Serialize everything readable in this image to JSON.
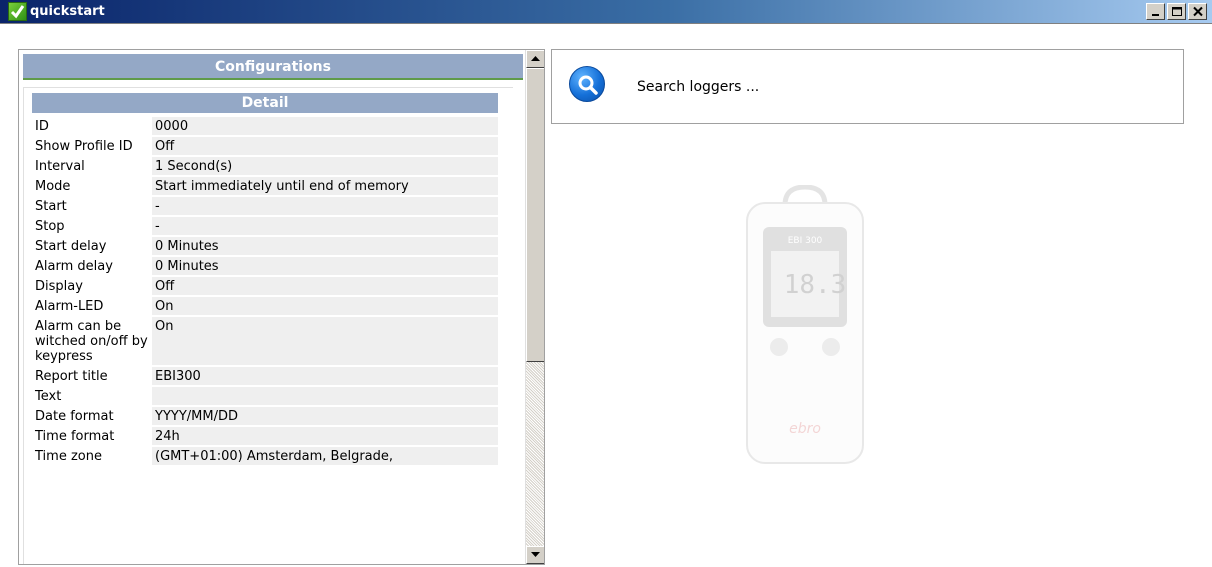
{
  "window": {
    "title": "quickstart",
    "controls": [
      "minimize",
      "maximize",
      "close"
    ]
  },
  "configurations": {
    "header": "Configurations",
    "detail": {
      "header": "Detail",
      "rows": [
        {
          "key": "ID",
          "value": "0000"
        },
        {
          "key": "Show Profile ID",
          "value": "Off"
        },
        {
          "key": "Interval",
          "value": "1 Second(s)"
        },
        {
          "key": "Mode",
          "value": "Start immediately until end of memory"
        },
        {
          "key": "Start",
          "value": "-"
        },
        {
          "key": "Stop",
          "value": "-"
        },
        {
          "key": "Start delay",
          "value": "0 Minutes"
        },
        {
          "key": "Alarm delay",
          "value": "0 Minutes"
        },
        {
          "key": "Display",
          "value": "Off"
        },
        {
          "key": "Alarm-LED",
          "value": "On"
        },
        {
          "key": "Alarm can be witched on/off by keypress",
          "value": "On"
        },
        {
          "key": "Report title",
          "value": "EBI300"
        },
        {
          "key": "Text",
          "value": ""
        },
        {
          "key": "Date format",
          "value": "YYYY/MM/DD"
        },
        {
          "key": "Time format",
          "value": "24h"
        },
        {
          "key": "Time zone",
          "value": "(GMT+01:00) Amsterdam, Belgrade,"
        }
      ]
    }
  },
  "search": {
    "label": "Search loggers ...",
    "icon": "search-icon"
  },
  "device": {
    "model": "EBI 300",
    "display_value": "18.3",
    "brand": "ebro"
  },
  "colors": {
    "title_bar_start": "#0a246a",
    "header_bg": "#94a8c6",
    "row_value_bg": "#efefef"
  }
}
